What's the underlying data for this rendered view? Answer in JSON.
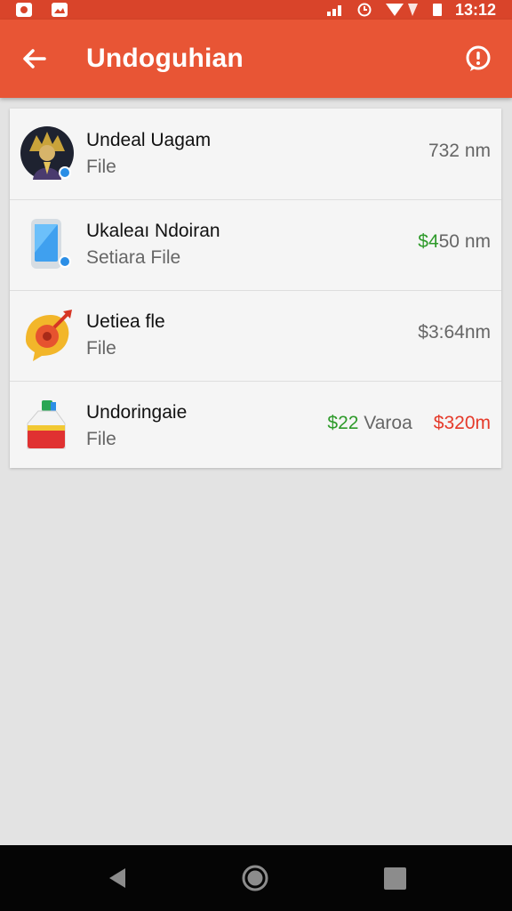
{
  "status_bar": {
    "time": "13:12"
  },
  "app_bar": {
    "title": "Undoguhian"
  },
  "items": [
    {
      "title": "Undeal Uagam",
      "subtitle": "File",
      "value": "732 nm"
    },
    {
      "title": "Ukaleaı Ndoiran",
      "subtitle": "Setiara File",
      "value_accent": "$4",
      "value": "50 nm"
    },
    {
      "title": "Uetiea fle",
      "subtitle": "File",
      "value": "$3:64nm"
    },
    {
      "title": "Undoringaie",
      "subtitle": "File",
      "value_accent": "$22",
      "value_mid": "Varoa",
      "value_red": "$320m"
    }
  ],
  "colors": {
    "status_bar": "#d9442a",
    "app_bar": "#e85535",
    "green": "#2e9a2a",
    "red": "#e53a2a"
  },
  "icons": [
    "back-arrow-icon",
    "alert-icon",
    "profile-avatar-icon",
    "phone-app-icon",
    "media-disc-icon",
    "bottle-icon",
    "nav-back-icon",
    "nav-home-icon",
    "nav-recent-icon"
  ]
}
